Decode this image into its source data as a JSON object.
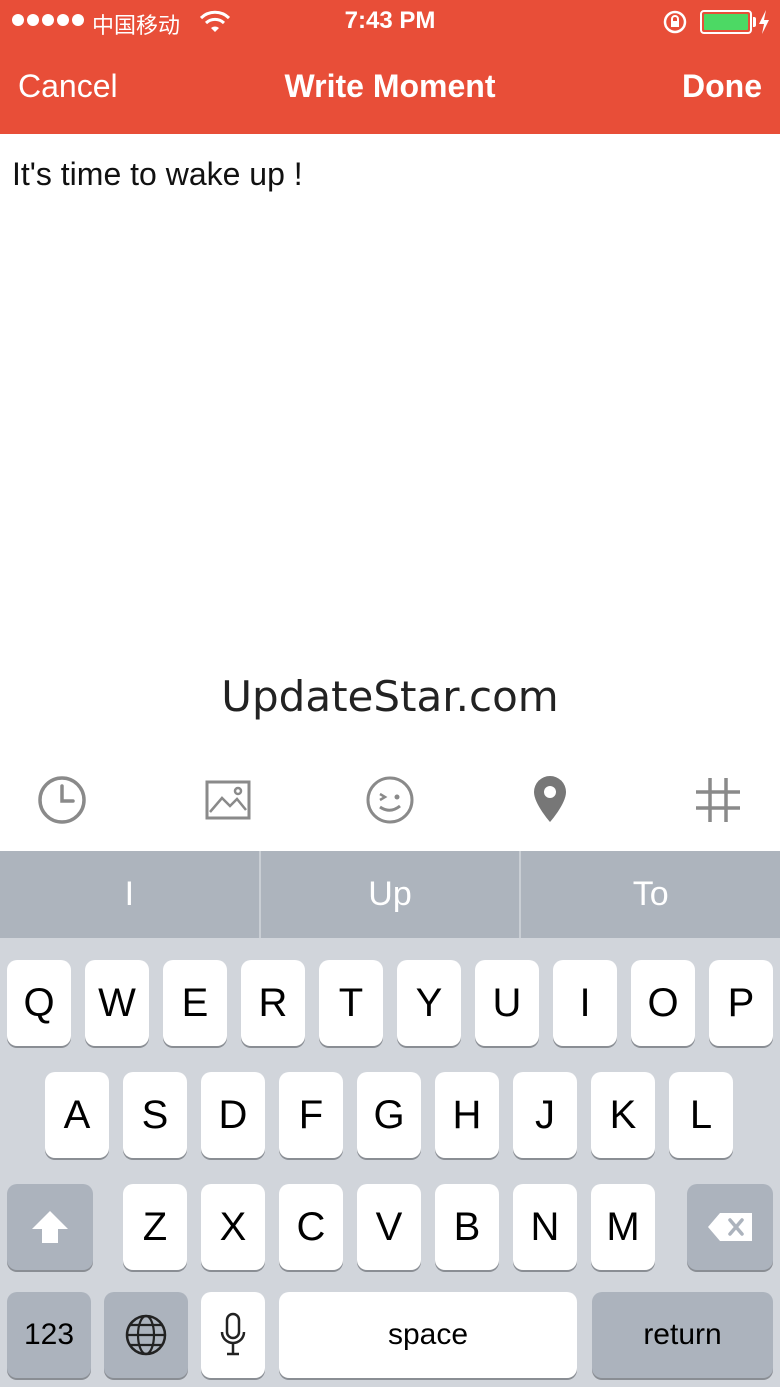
{
  "status_bar": {
    "carrier": "中国移动",
    "time": "7:43 PM",
    "icons": [
      "signal-dots-icon",
      "wifi-icon",
      "orientation-lock-icon",
      "battery-icon",
      "charging-bolt-icon"
    ]
  },
  "nav": {
    "cancel_label": "Cancel",
    "title": "Write Moment",
    "done_label": "Done"
  },
  "editor": {
    "text": "It's time to wake up !"
  },
  "watermark": "UpdateStar.com",
  "toolbar": {
    "icons": [
      "clock-icon",
      "image-icon",
      "emoji-icon",
      "location-pin-icon",
      "hashtag-icon"
    ]
  },
  "suggestions": [
    "I",
    "Up",
    "To"
  ],
  "keyboard": {
    "row1": [
      "Q",
      "W",
      "E",
      "R",
      "T",
      "Y",
      "U",
      "I",
      "O",
      "P"
    ],
    "row2": [
      "A",
      "S",
      "D",
      "F",
      "G",
      "H",
      "J",
      "K",
      "L"
    ],
    "row3": [
      "Z",
      "X",
      "C",
      "V",
      "B",
      "N",
      "M"
    ],
    "numbers_label": "123",
    "space_label": "space",
    "return_label": "return"
  },
  "colors": {
    "header": "#e84e38",
    "battery": "#4cd964",
    "keyboard_bg": "#d1d5db",
    "suggestion_bg": "#adb4bd"
  }
}
